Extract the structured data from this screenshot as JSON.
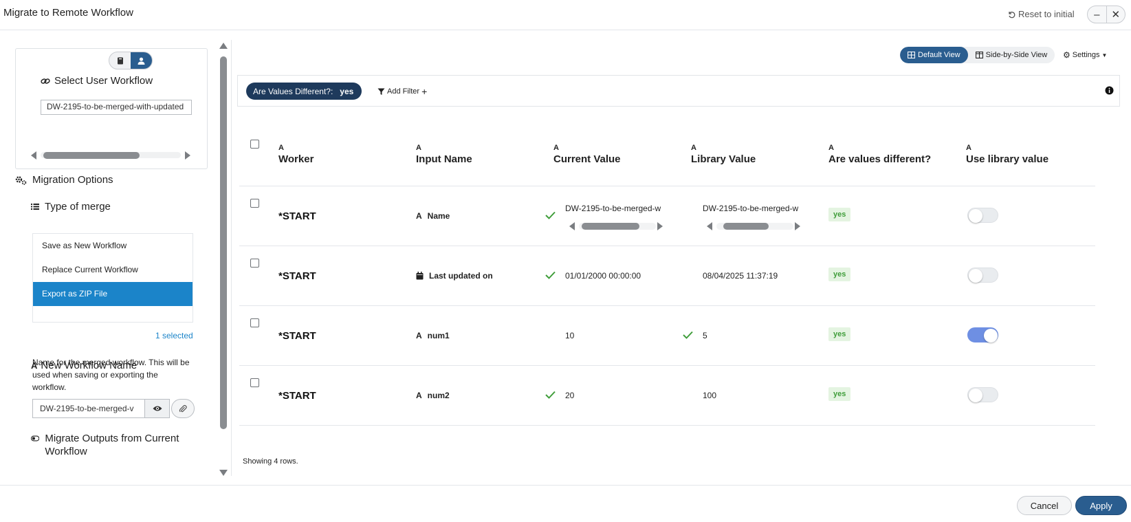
{
  "window": {
    "title": "Migrate to Remote Workflow",
    "reset_label": "Reset to initial",
    "minimize": "–",
    "close": "✕"
  },
  "left": {
    "select_user_workflow_label": "Select User Workflow",
    "workflow_value": "DW-2195-to-be-merged-with-updated",
    "migration_options_label": "Migration Options",
    "type_of_merge_label": "Type of merge",
    "merge_options": [
      "Save as New Workflow",
      "Replace Current Workflow",
      "Export as ZIP File"
    ],
    "merge_selected": "Export as ZIP File",
    "selected_count": "1 selected",
    "new_workflow_name_label": "New Workflow Name",
    "new_workflow_name_desc": "Name for the merged workflow. This will be used when saving or exporting the workflow.",
    "new_workflow_name_value": "DW-2195-to-be-merged-v",
    "migrate_outputs_label": "Migrate Outputs from Current Workflow"
  },
  "main": {
    "view_default": "Default View",
    "view_side": "Side-by-Side View",
    "settings": "Settings",
    "filter_chip_label": "Are Values Different?:",
    "filter_chip_value": "yes",
    "add_filter": "Add Filter",
    "columns": [
      "Worker",
      "Input Name",
      "Current Value",
      "Library Value",
      "Are values different?",
      "Use library value"
    ],
    "column_type_glyph": "A",
    "rows": [
      {
        "worker": "*START",
        "input": "Name",
        "input_icon": "text-type-icon",
        "current": "DW-2195-to-be-merged-w",
        "library": "DW-2195-to-be-merged-w",
        "check": "current",
        "different": "yes",
        "use_library": false
      },
      {
        "worker": "*START",
        "input": "Last updated on",
        "input_icon": "calendar-icon",
        "current": "01/01/2000 00:00:00",
        "library": "08/04/2025 11:37:19",
        "check": "current",
        "different": "yes",
        "use_library": false
      },
      {
        "worker": "*START",
        "input": "num1",
        "input_icon": "text-type-icon",
        "current": "10",
        "library": "5",
        "check": "library",
        "different": "yes",
        "use_library": true
      },
      {
        "worker": "*START",
        "input": "num2",
        "input_icon": "text-type-icon",
        "current": "20",
        "library": "100",
        "check": "current",
        "different": "yes",
        "use_library": false
      }
    ],
    "footer": "Showing 4 rows."
  },
  "buttons": {
    "cancel": "Cancel",
    "apply": "Apply"
  }
}
